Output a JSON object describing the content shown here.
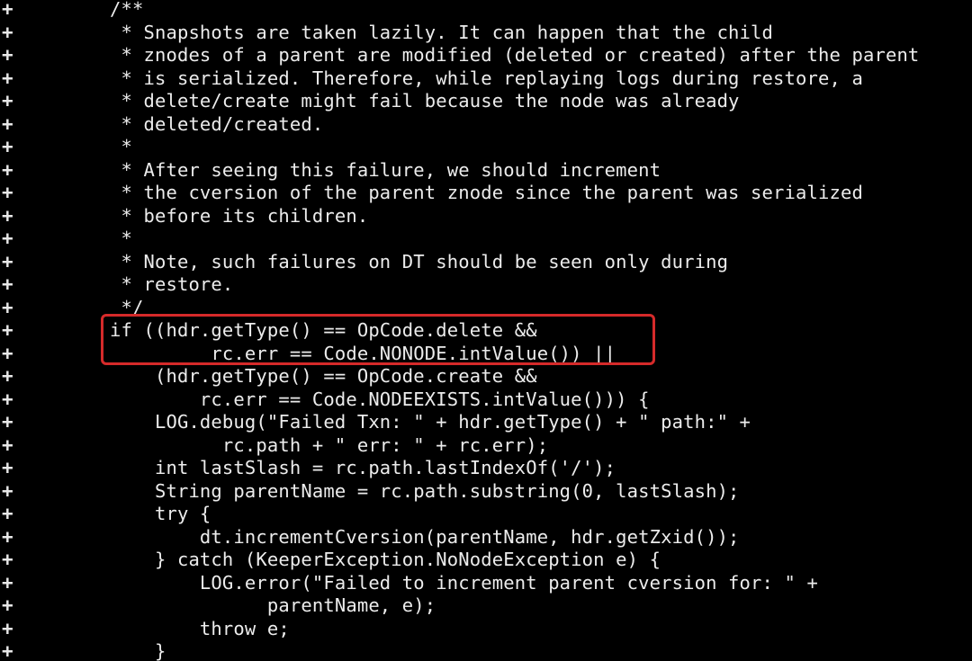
{
  "diff": {
    "marker": "+",
    "highlight_color": "#d62a2a",
    "lines": [
      "/**",
      " * Snapshots are taken lazily. It can happen that the child",
      " * znodes of a parent are modified (deleted or created) after the parent",
      " * is serialized. Therefore, while replaying logs during restore, a",
      " * delete/create might fail because the node was already",
      " * deleted/created.",
      " *",
      " * After seeing this failure, we should increment",
      " * the cversion of the parent znode since the parent was serialized",
      " * before its children.",
      " *",
      " * Note, such failures on DT should be seen only during",
      " * restore.",
      " */",
      "if ((hdr.getType() == OpCode.delete &&",
      "         rc.err == Code.NONODE.intValue()) ||",
      "    (hdr.getType() == OpCode.create &&",
      "        rc.err == Code.NODEEXISTS.intValue())) {",
      "    LOG.debug(\"Failed Txn: \" + hdr.getType() + \" path:\" +",
      "          rc.path + \" err: \" + rc.err);",
      "    int lastSlash = rc.path.lastIndexOf('/');",
      "    String parentName = rc.path.substring(0, lastSlash);",
      "    try {",
      "        dt.incrementCversion(parentName, hdr.getZxid());",
      "    } catch (KeeperException.NoNodeException e) {",
      "        LOG.error(\"Failed to increment parent cversion for: \" +",
      "              parentName, e);",
      "        throw e;",
      "    }"
    ]
  }
}
